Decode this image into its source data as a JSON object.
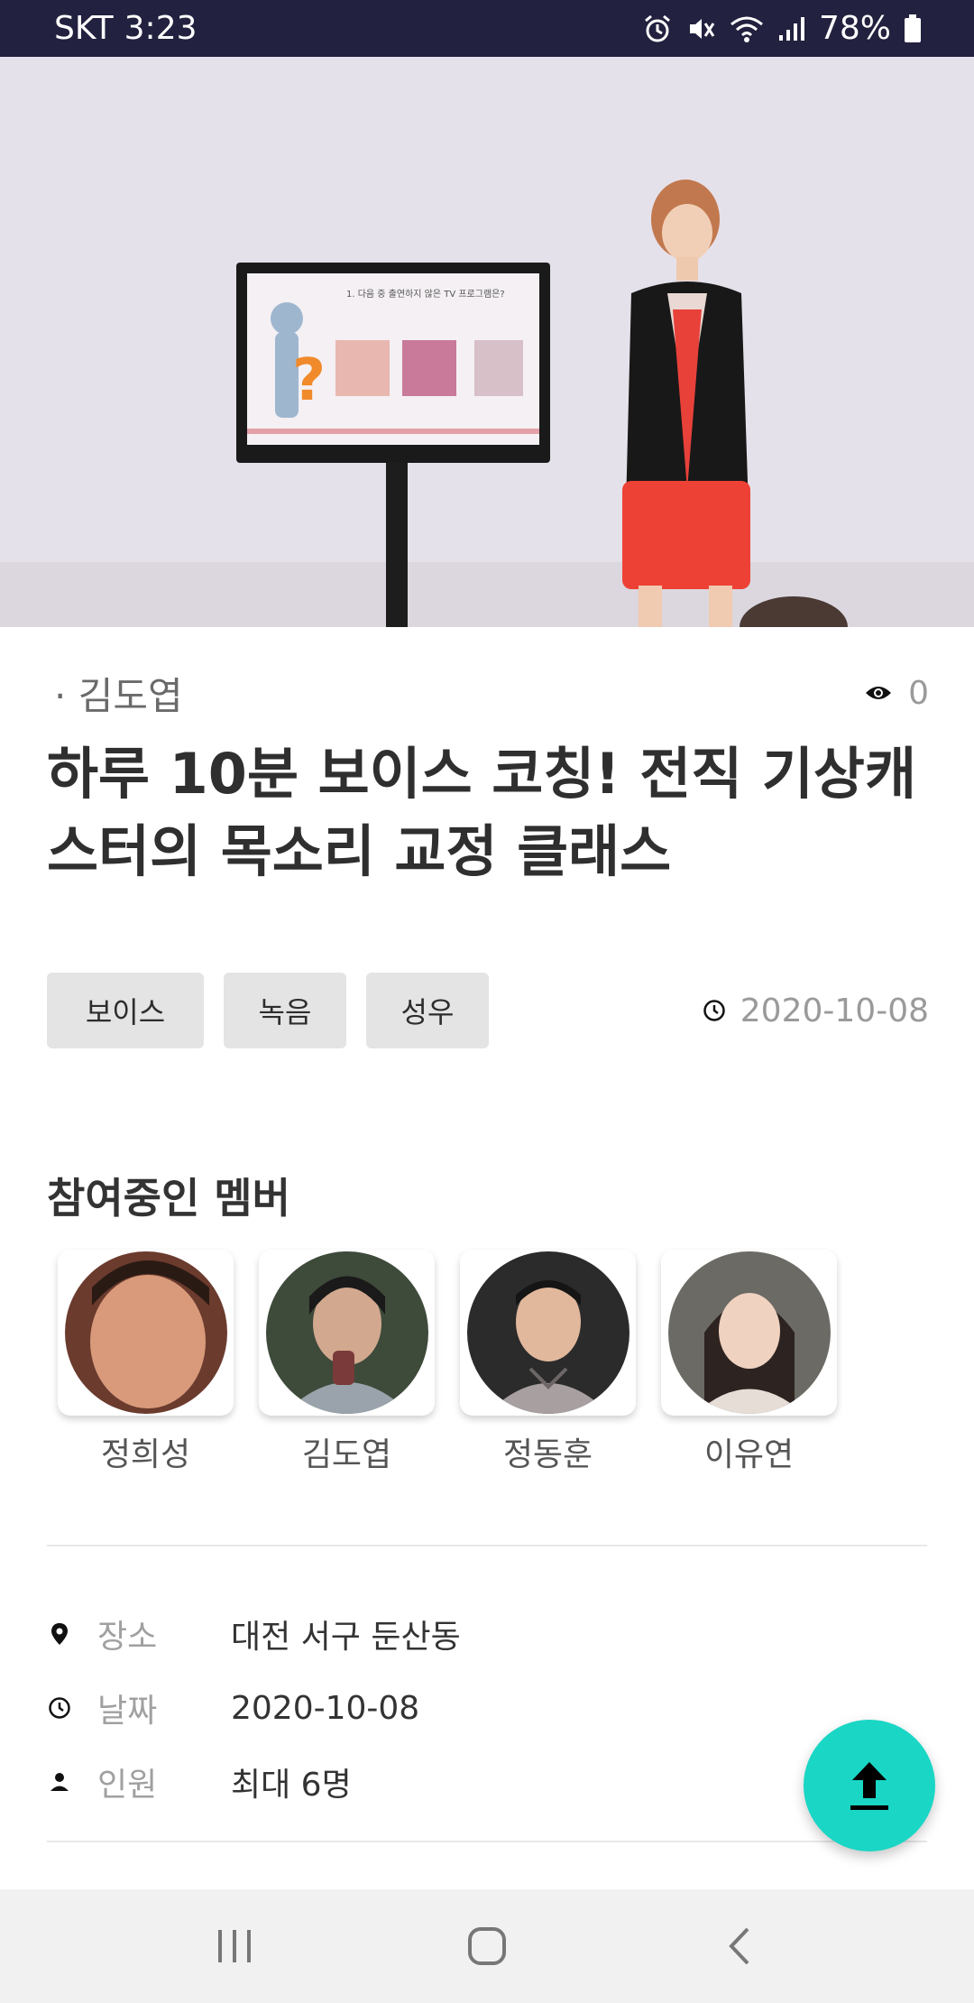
{
  "status_bar": {
    "carrier": "SKT",
    "time": "3:23",
    "battery": "78%"
  },
  "hero": {
    "screen_text": "1. 다음 중 출연하지 않은 TV 프로그램은?"
  },
  "post": {
    "author": "· 김도엽",
    "views": "0",
    "title": "하루 10분 보이스 코칭! 전직 기상캐스터의 목소리 교정 클래스",
    "tags": [
      "보이스",
      "녹음",
      "성우"
    ],
    "date": "2020-10-08"
  },
  "members": {
    "title": "참여중인 멤버",
    "items": [
      {
        "name": "정희성"
      },
      {
        "name": "김도엽"
      },
      {
        "name": "정동훈"
      },
      {
        "name": "이유연"
      }
    ]
  },
  "info": {
    "place_label": "장소",
    "place_value": "대전 서구 둔산동",
    "date_label": "날짜",
    "date_value": "2020-10-08",
    "people_label": "인원",
    "people_value": "최대 6명"
  },
  "colors": {
    "status_bar": "#22213f",
    "accent": "#19d6c5",
    "tag_bg": "#e4e4e4"
  },
  "icons": {
    "views": "eye-icon",
    "date": "clock-icon",
    "place": "location-pin-icon",
    "people": "person-icon",
    "fab": "upload-arrow-icon",
    "nav_recent": "recent-apps-icon",
    "nav_home": "home-icon",
    "nav_back": "back-icon"
  }
}
